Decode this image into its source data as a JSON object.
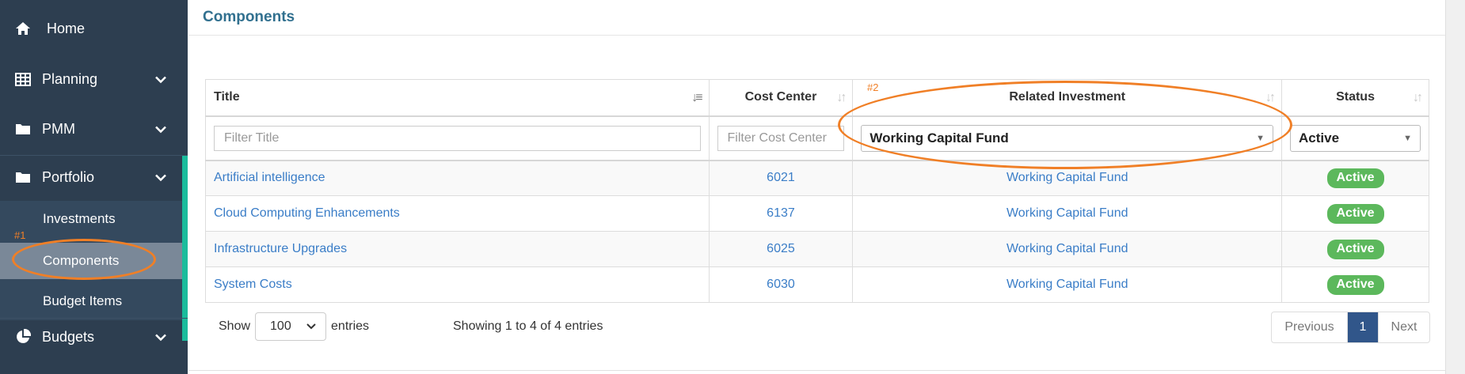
{
  "sidebar": {
    "items": [
      {
        "label": "Home",
        "icon": "home-icon"
      },
      {
        "label": "Planning",
        "icon": "table-icon"
      },
      {
        "label": "PMM",
        "icon": "folder-icon"
      },
      {
        "label": "Portfolio",
        "icon": "folder-icon"
      },
      {
        "label": "Budgets",
        "icon": "pie-chart-icon"
      }
    ],
    "portfolio_submenu": [
      "Investments",
      "Components",
      "Budget Items"
    ],
    "active_item": "Components"
  },
  "annotations": {
    "first": "#1",
    "second": "#2",
    "color": "#f07f26"
  },
  "page": {
    "title": "Components"
  },
  "table": {
    "columns": [
      "Title",
      "Cost Center",
      "Related Investment",
      "Status"
    ],
    "filters": {
      "title_placeholder": "Filter Title",
      "cost_center_placeholder": "Filter Cost Center",
      "related_investment_value": "Working Capital Fund",
      "status_value": "Active"
    },
    "rows": [
      {
        "title": "Artificial intelligence",
        "cost_center": "6021",
        "investment": "Working Capital Fund",
        "status": "Active"
      },
      {
        "title": "Cloud Computing Enhancements",
        "cost_center": "6137",
        "investment": "Working Capital Fund",
        "status": "Active"
      },
      {
        "title": "Infrastructure Upgrades",
        "cost_center": "6025",
        "investment": "Working Capital Fund",
        "status": "Active"
      },
      {
        "title": "System Costs",
        "cost_center": "6030",
        "investment": "Working Capital Fund",
        "status": "Active"
      }
    ]
  },
  "footer": {
    "show_label": "Show",
    "page_length": "100",
    "entries_label": "entries",
    "info": "Showing 1 to 4 of 4 entries",
    "pagination": {
      "previous": "Previous",
      "current": "1",
      "next": "Next"
    }
  },
  "colors": {
    "sidebar": "#2d3e50",
    "accent": "#1abc9c",
    "link": "#3a7dc7",
    "status_active": "#5cb85c",
    "page_active": "#31568a"
  }
}
